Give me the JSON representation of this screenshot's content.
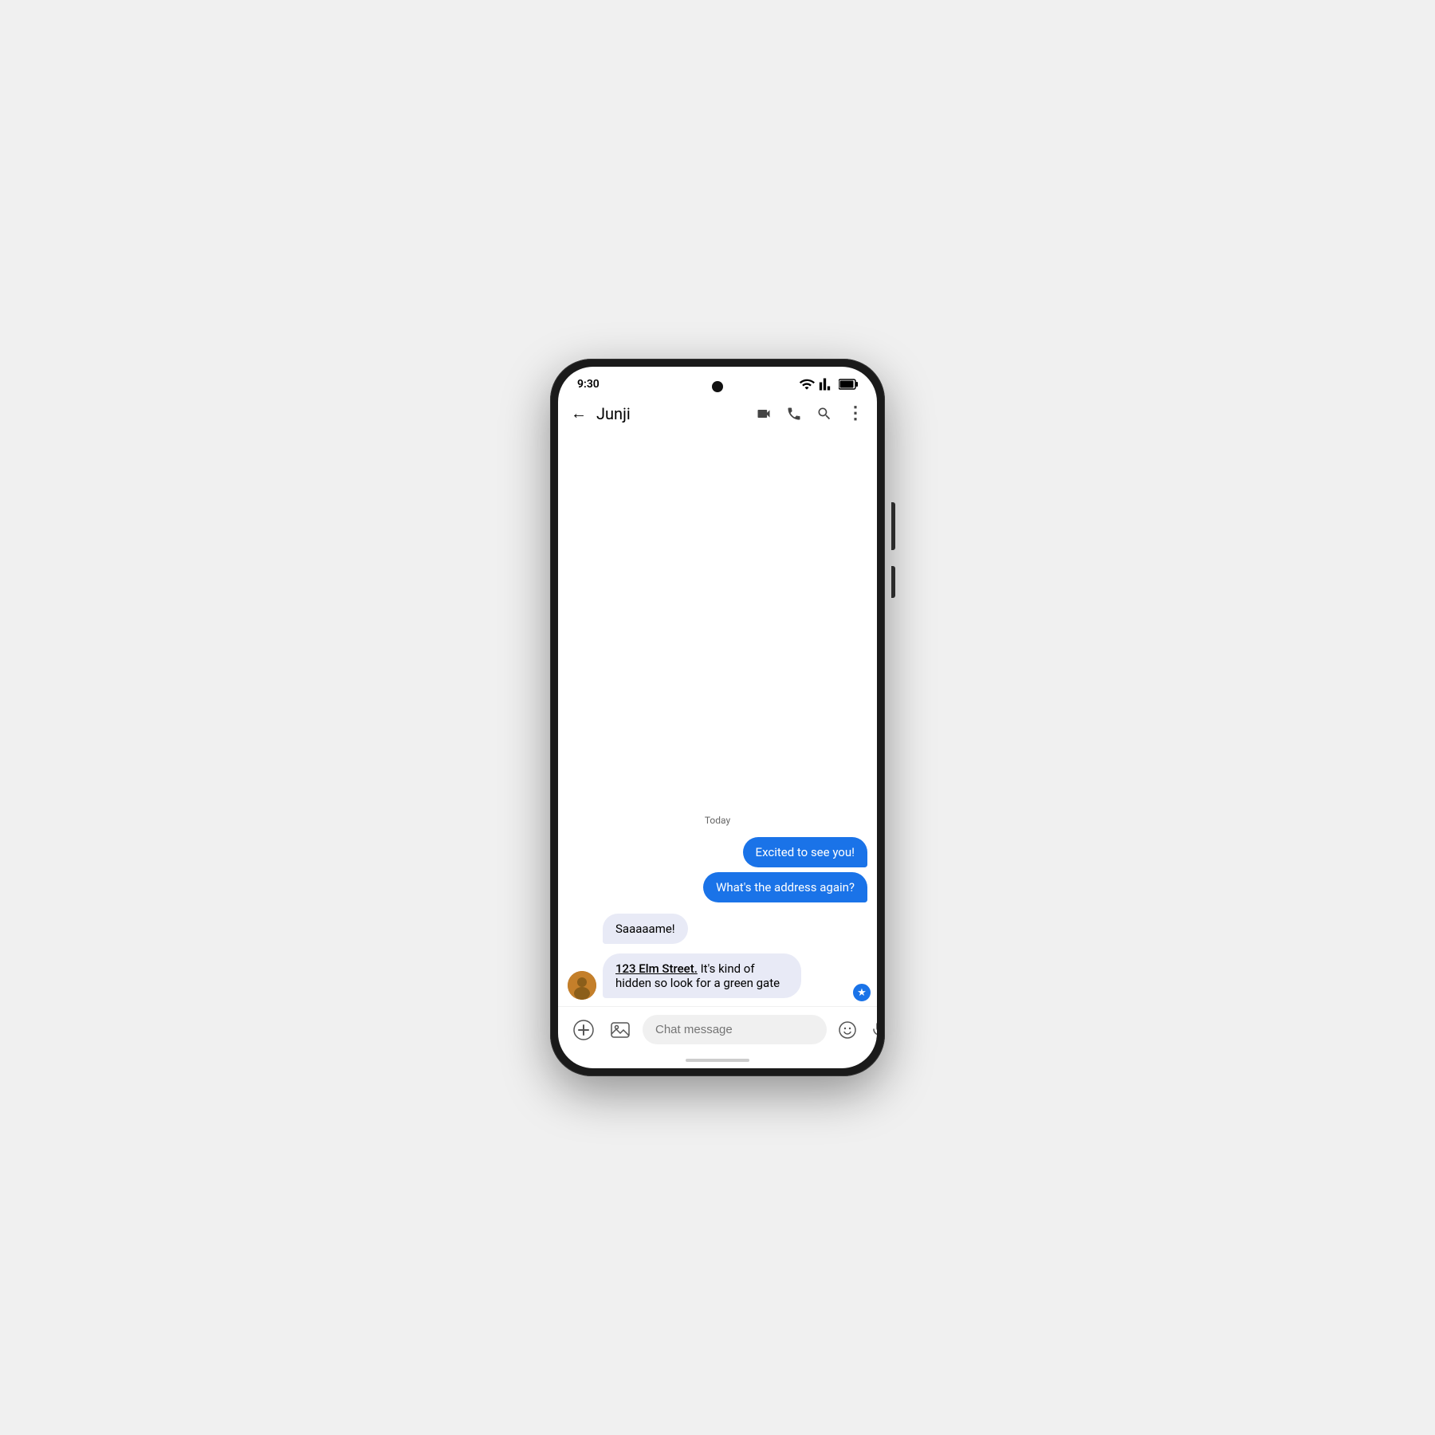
{
  "status_bar": {
    "time": "9:30"
  },
  "app_bar": {
    "contact_name": "Junji",
    "back_label": "←"
  },
  "chat": {
    "date_separator": "Today",
    "sent_messages": [
      {
        "id": 1,
        "text": "Excited to see you!"
      },
      {
        "id": 2,
        "text": "What's the address again?"
      }
    ],
    "received_messages": [
      {
        "id": 3,
        "text": "Saaaaame!",
        "has_avatar": false
      },
      {
        "id": 4,
        "text_prefix": "123 Elm Street.",
        "text_suffix": " It's kind of hidden so look for a green gate",
        "has_avatar": true,
        "has_star": true
      }
    ]
  },
  "input_bar": {
    "placeholder": "Chat message"
  },
  "icons": {
    "back": "←",
    "video_call": "📹",
    "phone": "📞",
    "search": "🔍",
    "more": "⋮",
    "add": "+",
    "emoji": "☺",
    "mic": "🎤"
  }
}
